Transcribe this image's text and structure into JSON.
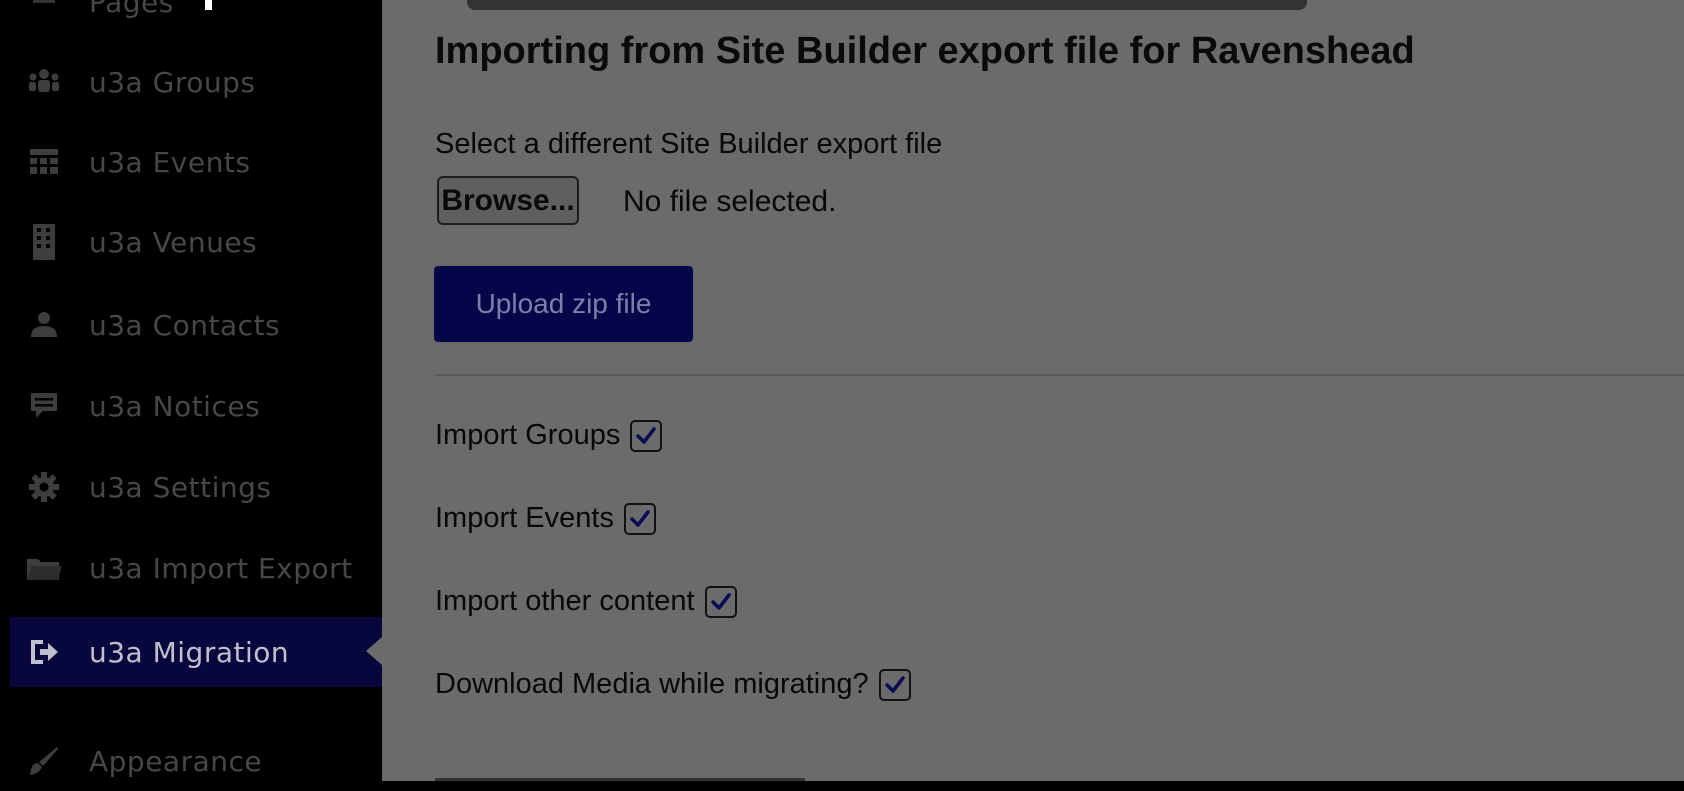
{
  "sidebar": {
    "items": [
      {
        "label": "Pages",
        "icon": "pages-icon"
      },
      {
        "label": "u3a Groups",
        "icon": "groups-icon"
      },
      {
        "label": "u3a Events",
        "icon": "calendar-icon"
      },
      {
        "label": "u3a Venues",
        "icon": "building-icon"
      },
      {
        "label": "u3a Contacts",
        "icon": "contact-icon"
      },
      {
        "label": "u3a Notices",
        "icon": "notice-icon"
      },
      {
        "label": "u3a Settings",
        "icon": "gear-icon"
      },
      {
        "label": "u3a Import Export",
        "icon": "folder-icon"
      },
      {
        "label": "u3a Migration",
        "icon": "migration-icon",
        "current": true
      },
      {
        "label": "Appearance",
        "icon": "brush-icon"
      }
    ]
  },
  "main": {
    "title": "Importing from Site Builder export file for Ravenshead",
    "file_label": "Select a different Site Builder export file",
    "browse_label": "Browse...",
    "file_status": "No file selected.",
    "upload_label": "Upload zip file",
    "options": [
      {
        "label": "Import Groups",
        "checked": true
      },
      {
        "label": "Import Events",
        "checked": true
      },
      {
        "label": "Import other content",
        "checked": true
      },
      {
        "label": "Download Media while migrating?",
        "checked": true
      }
    ]
  }
}
